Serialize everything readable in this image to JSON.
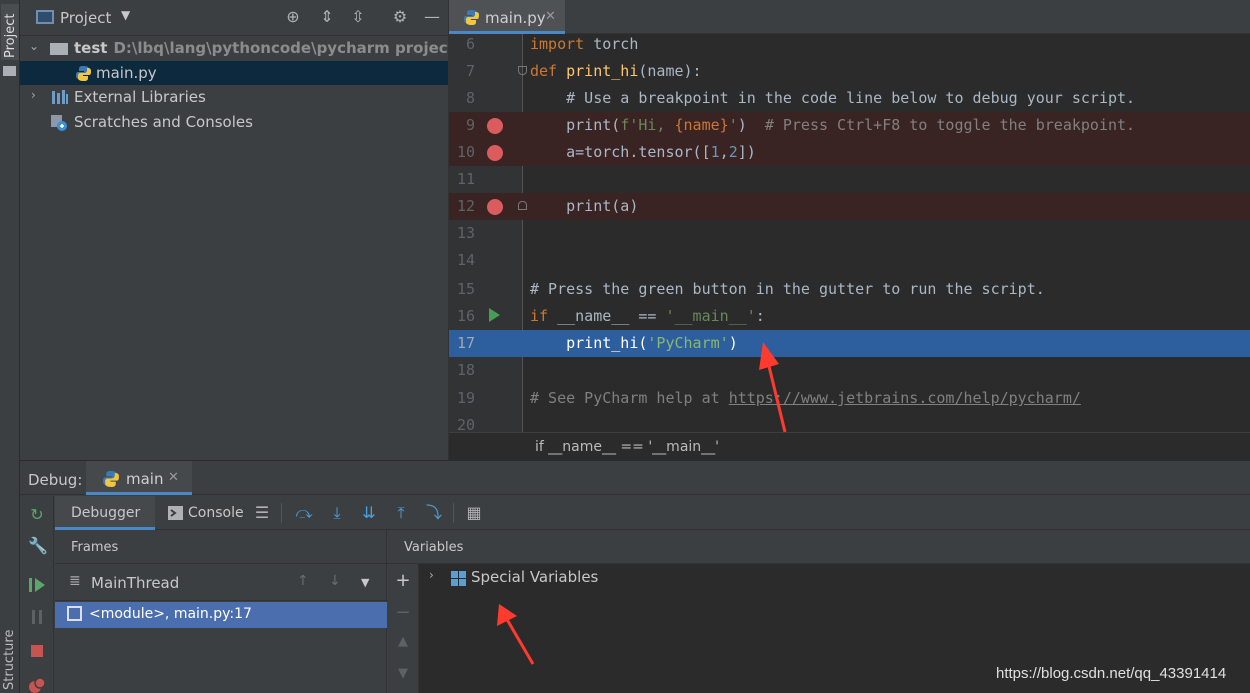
{
  "sidebar_strip": {
    "project_label": "Project",
    "structure_label": "Structure"
  },
  "project_panel": {
    "title": "Project",
    "tree": [
      {
        "label": "test",
        "path": "D:\\lbq\\lang\\pythoncode\\pycharm project\\test"
      },
      {
        "label": "main.py"
      },
      {
        "label": "External Libraries"
      },
      {
        "label": "Scratches and Consoles"
      }
    ]
  },
  "editor": {
    "tab": {
      "label": "main.py"
    },
    "lines": [
      {
        "num": "6"
      },
      {
        "num": "7"
      },
      {
        "num": "8"
      },
      {
        "num": "9"
      },
      {
        "num": "10"
      },
      {
        "num": "11"
      },
      {
        "num": "12"
      },
      {
        "num": "13"
      },
      {
        "num": "14"
      },
      {
        "num": "15"
      },
      {
        "num": "16"
      },
      {
        "num": "17"
      },
      {
        "num": "18"
      },
      {
        "num": "19"
      },
      {
        "num": "20"
      }
    ],
    "code": {
      "l6_kw": "import",
      "l6_rest": " torch",
      "l7_kw": "def",
      "l7_fn": "print_hi",
      "l7_rest": "(name):",
      "l8": "    # Use a breakpoint in the code line below to debug your script.",
      "l9_pre": "    print(",
      "l9_str1": "f'Hi, ",
      "l9_brace": "{name}",
      "l9_str2": "'",
      "l9_post": ")  ",
      "l9_cm": "# Press Ctrl+F8 to toggle the breakpoint.",
      "l10_pre": "    a=torch.tensor([",
      "l10_n1": "1",
      "l10_c": ",",
      "l10_n2": "2",
      "l10_post": "])",
      "l12": "    print(a)",
      "l15": "# Press the green button in the gutter to run the script.",
      "l16_kw": "if",
      "l16_mid": " __name__ == ",
      "l16_str": "'__main__'",
      "l16_post": ":",
      "l17_pre": "    print_hi(",
      "l17_str": "'PyCharm'",
      "l17_post": ")",
      "l19_pre": "# See PyCharm help at ",
      "l19_link": "https://www.jetbrains.com/help/pycharm/"
    },
    "breadcrumb": "if __name__ == '__main__'"
  },
  "debug": {
    "label": "Debug:",
    "tab": "main",
    "tabs": {
      "debugger": "Debugger",
      "console": "Console"
    },
    "frames": {
      "header": "Frames",
      "thread": "MainThread",
      "selected_frame": "<module>, main.py:17"
    },
    "variables": {
      "header": "Variables",
      "items": [
        {
          "label": "Special Variables"
        }
      ]
    }
  },
  "watermark": "https://blog.csdn.net/qq_43391414",
  "colors": {
    "accent": "#4a88c7",
    "breakpoint": "#db5c5c",
    "current_line": "#2d5e9e",
    "annotation_arrow": "#ff3b30"
  }
}
